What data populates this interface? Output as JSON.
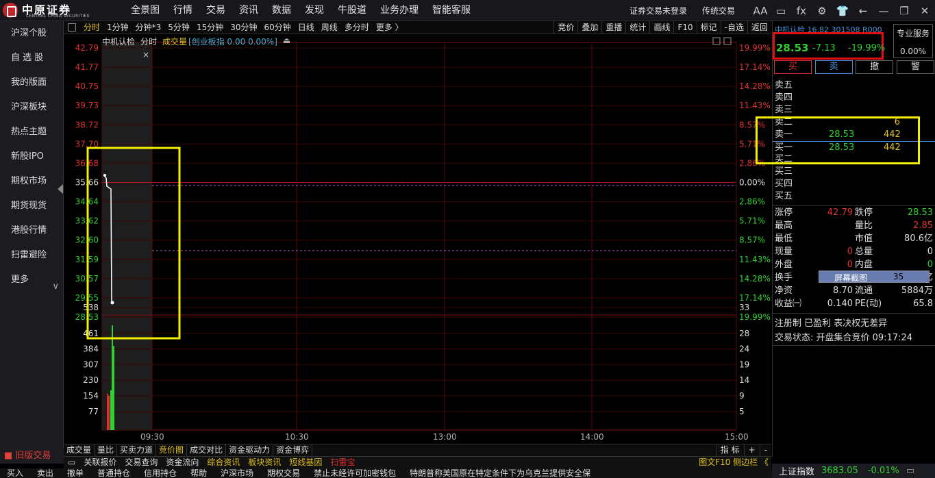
{
  "topbar": {
    "logo_text": "中原证券",
    "logo_sub": "CENTRAL CHINA SECURITIES",
    "menu": [
      "全景图",
      "行情",
      "交易",
      "资讯",
      "数据",
      "发现",
      "牛股道",
      "业务办理",
      "智能客服"
    ],
    "login_status": "证券交易未登录",
    "mode": "传统交易",
    "icons": [
      "font-size-icon",
      "keyboard-icon",
      "formula-icon",
      "gear-icon",
      "shirt-icon",
      "back-arrow-icon",
      "minimize-icon",
      "restore-icon",
      "close-icon"
    ],
    "icon_glyphs": [
      "AA",
      "▭",
      "fx",
      "⚙",
      "👕",
      "←",
      "—",
      "❐",
      "✕"
    ]
  },
  "leftnav": {
    "items": [
      "沪深个股",
      "自 选 股",
      "我的版面",
      "沪深板块",
      "热点主题",
      "新股IPO",
      "期权市场",
      "期货现货",
      "港股行情",
      "扫雷避险",
      "更多"
    ],
    "more_glyph": "∨",
    "old_version": "旧版交易"
  },
  "toolbar": {
    "periods": [
      "分时",
      "1分钟",
      "分钟*3",
      "5分钟",
      "15分钟",
      "30分钟",
      "60分钟",
      "日线",
      "周线",
      "多分时",
      "更多 〉"
    ],
    "active": "分时",
    "right": [
      "竞价",
      "叠加",
      "重播",
      "统计",
      "画线",
      "F10",
      "标记",
      "-自选",
      "返回"
    ]
  },
  "chart": {
    "header": {
      "name": "中机认检",
      "mode": "分时",
      "ind_label": "成交量",
      "index_note": "[创业板指 0.00 0.00%]"
    },
    "price_axis": [
      "42.79",
      "41.77",
      "40.75",
      "39.73",
      "38.72",
      "37.70",
      "36.68",
      "35.66",
      "34.64",
      "33.62",
      "32.60",
      "31.59",
      "30.57",
      "29.55",
      "28.53"
    ],
    "pct_axis": [
      "19.99%",
      "17.14%",
      "14.28%",
      "11.43%",
      "8.57%",
      "5.71%",
      "2.86%",
      "0.00%",
      "2.86%",
      "5.71%",
      "8.57%",
      "11.43%",
      "14.28%",
      "17.14%",
      "19.99%"
    ],
    "vol_axis_left": [
      "538",
      "461",
      "384",
      "307",
      "230",
      "154",
      "77"
    ],
    "vol_axis_right": [
      "33",
      "28",
      "24",
      "19",
      "14",
      "9",
      "5"
    ],
    "time_axis": [
      "09:30",
      "10:30",
      "13:00",
      "14:00",
      "15:00"
    ],
    "close_glyph": "×"
  },
  "bottom_tabs": {
    "items": [
      "成交量",
      "量比",
      "买卖力道",
      "竞价图",
      "成交对比",
      "资金驱动力",
      "资金博弈"
    ],
    "active": "竞价图",
    "right": [
      "指 标",
      "+",
      "-"
    ]
  },
  "news_bar": {
    "items": [
      "关联报价",
      "交易查询",
      "资金流向",
      "综合资讯",
      "板块资讯",
      "短线基因",
      "扫雷宝"
    ],
    "right": "图文F10 侧边栏 《"
  },
  "bottom_strip": [
    "买入",
    "卖出",
    "撤单",
    "普通持仓",
    "信用持仓",
    "帮助",
    "沪深市场",
    "期权交易",
    "禁止未经许可加密钱包",
    "特朗普称美国原在特定条件下为乌克兰提供安全保"
  ],
  "quote": {
    "title": "中机认检 16.82 301508 R000",
    "price": "28.53",
    "change": "-7.13",
    "pct": "-19.99%",
    "pro_label": "专业服务",
    "pro_value": "0.00%",
    "buttons": [
      "买",
      "卖",
      "撤",
      "警"
    ],
    "book": [
      {
        "label": "卖五",
        "price": "",
        "vol": ""
      },
      {
        "label": "卖四",
        "price": "",
        "vol": ""
      },
      {
        "label": "卖三",
        "price": "",
        "vol": ""
      },
      {
        "label": "卖二",
        "price": "",
        "vol": "6"
      },
      {
        "label": "卖一",
        "price": "28.53",
        "vol": "442"
      },
      {
        "label": "买一",
        "price": "28.53",
        "vol": "442"
      },
      {
        "label": "买二",
        "price": "",
        "vol": ""
      },
      {
        "label": "买三",
        "price": "",
        "vol": ""
      },
      {
        "label": "买四",
        "price": "",
        "vol": ""
      },
      {
        "label": "买五",
        "price": "",
        "vol": ""
      }
    ],
    "stats": [
      {
        "a": "涨停",
        "av": "42.79",
        "b": "跌停",
        "bv": "28.53"
      },
      {
        "a": "最高",
        "av": "",
        "b": "量比",
        "bv": "2.85"
      },
      {
        "a": "最低",
        "av": "",
        "b": "市值",
        "bv": "80.6亿"
      },
      {
        "a": "现量",
        "av": "0",
        "b": "总量",
        "bv": "0"
      },
      {
        "a": "外盘",
        "av": "0",
        "b": "内盘",
        "bv": "0"
      },
      {
        "a": "换手",
        "av": "0.",
        "b": "",
        "bv": ".26亿"
      },
      {
        "a": "净资",
        "av": "8.70",
        "b": "流通",
        "bv": "5884万"
      },
      {
        "a": "收益㈠",
        "av": "0.140",
        "b": "PE(动)",
        "bv": "65.8"
      }
    ],
    "popup": {
      "label": "屏幕截图",
      "num": "35"
    },
    "register": "注册制 已盈利 表决权无差异",
    "trade_status": "交易状态: 开盘集合竞价 09:17:24"
  },
  "index_bar": {
    "name": "上证指数",
    "value": "3683.05",
    "pct": "-0.01%"
  },
  "colors": {
    "up": "#e03030",
    "down": "#30d030",
    "vol": "#e0c020",
    "grid": "#7a1010",
    "highlight": "#f5f000",
    "box": "#e01010"
  }
}
